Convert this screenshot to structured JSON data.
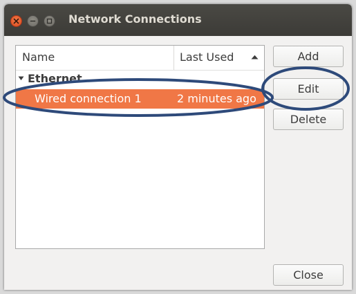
{
  "window": {
    "title": "Network Connections"
  },
  "connections_list": {
    "columns": {
      "name": "Name",
      "last_used": "Last Used"
    },
    "sort": "ascending",
    "groups": [
      {
        "label": "Ethernet",
        "expanded": true,
        "items": [
          {
            "name": "Wired connection 1",
            "last_used": "2 minutes ago",
            "selected": true
          }
        ]
      }
    ]
  },
  "buttons": {
    "add": "Add",
    "edit": "Edit",
    "delete": "Delete",
    "close": "Close"
  },
  "colors": {
    "selection": "#f07746",
    "titlebar": "#3c3b37",
    "annotation_ellipse": "#2e4a7a"
  },
  "annotations": [
    {
      "shape": "ellipse",
      "target": "Wired connection 1 row"
    },
    {
      "shape": "ellipse",
      "target": "Edit button"
    }
  ]
}
